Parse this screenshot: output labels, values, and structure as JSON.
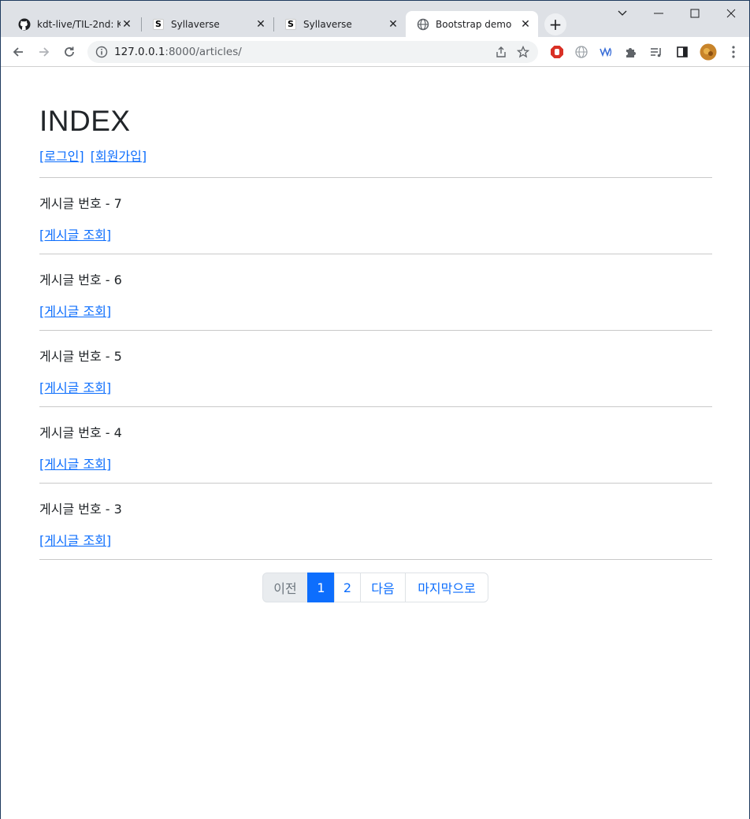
{
  "browser": {
    "tabs": [
      {
        "title": "kdt-live/TIL-2nd: KDT",
        "icon": "github-icon"
      },
      {
        "title": "Syllaverse",
        "icon": "s-favicon"
      },
      {
        "title": "Syllaverse",
        "icon": "s-favicon"
      },
      {
        "title": "Bootstrap demo",
        "icon": "globe-icon"
      }
    ],
    "url_host": "127.0.0.1",
    "url_rest": ":8000/articles/",
    "close_glyph": "✕",
    "newtab_glyph": "+"
  },
  "page": {
    "heading": "INDEX",
    "login_link": "[로그인]",
    "signup_link": "[회원가입]",
    "articles": [
      {
        "title": "게시글 번호 - 7",
        "link": "[게시글 조회]"
      },
      {
        "title": "게시글 번호 - 6",
        "link": "[게시글 조회]"
      },
      {
        "title": "게시글 번호 - 5",
        "link": "[게시글 조회]"
      },
      {
        "title": "게시글 번호 - 4",
        "link": "[게시글 조회]"
      },
      {
        "title": "게시글 번호 - 3",
        "link": "[게시글 조회]"
      }
    ],
    "pagination": {
      "prev": "이전",
      "pages": [
        "1",
        "2"
      ],
      "current": "1",
      "next": "다음",
      "last": "마지막으로"
    }
  },
  "colors": {
    "link": "#0d6efd",
    "active_page": "#0d6efd",
    "tabstrip": "#dee1e6"
  }
}
